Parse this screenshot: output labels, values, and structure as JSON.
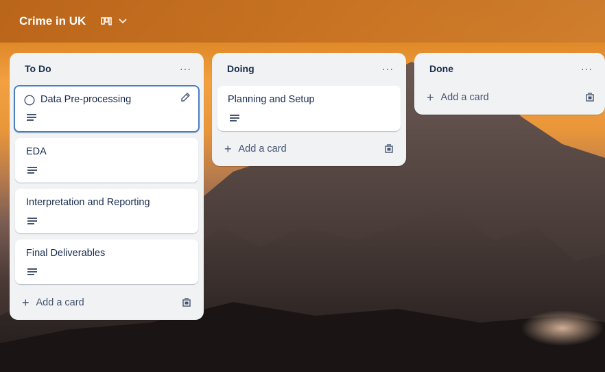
{
  "board": {
    "title": "Crime in UK"
  },
  "lists": [
    {
      "title": "To Do",
      "menu": "···",
      "cards": [
        "Data Pre-processing",
        "EDA",
        "Interpretation and Reporting",
        "Final Deliverables"
      ],
      "add_label": "Add a card"
    },
    {
      "title": "Doing",
      "menu": "···",
      "cards": [
        "Planning and Setup"
      ],
      "add_label": "Add a card"
    },
    {
      "title": "Done",
      "menu": "···",
      "cards": [],
      "add_label": "Add a card"
    }
  ],
  "colors": {
    "accent_border": "#4a7fc1",
    "list_bg": "#f1f2f4",
    "text": "#172b4d"
  }
}
